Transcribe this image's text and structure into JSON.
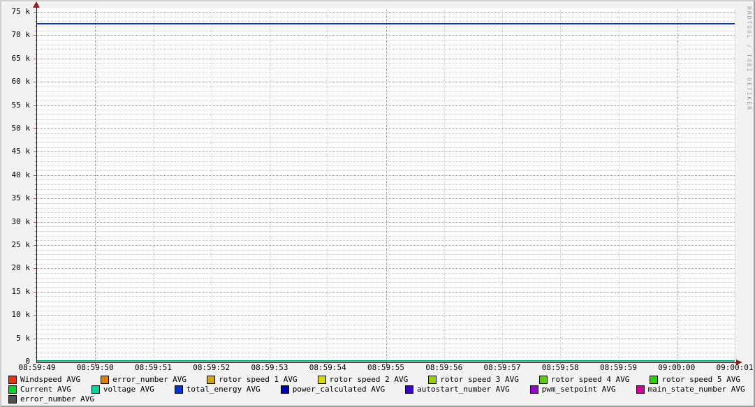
{
  "watermark": "RRDTOOL / TOBI OETIKER",
  "chart_data": {
    "type": "line",
    "title": "",
    "xlabel": "",
    "ylabel": "",
    "ylim": [
      0,
      75000
    ],
    "y_major_step": 5000,
    "y_minor_step": 1000,
    "y_tick_labels": [
      "0",
      "5 k",
      "10 k",
      "15 k",
      "20 k",
      "25 k",
      "30 k",
      "35 k",
      "40 k",
      "45 k",
      "50 k",
      "55 k",
      "60 k",
      "65 k",
      "70 k",
      "75 k"
    ],
    "x_labels": [
      "08:59:49",
      "08:59:50",
      "08:59:51",
      "08:59:52",
      "08:59:53",
      "08:59:54",
      "08:59:55",
      "08:59:56",
      "08:59:57",
      "08:59:58",
      "08:59:59",
      "09:00:00",
      "09:00:01"
    ],
    "x_major_indices": [
      1,
      6,
      11
    ],
    "grid": "on",
    "legend_position": "bottom",
    "series": [
      {
        "name": "Windspeed AVG",
        "color": "#e0370d",
        "row": 0,
        "value": 0
      },
      {
        "name": "error_number AVG",
        "color": "#db8300",
        "row": 0,
        "value": 0
      },
      {
        "name": "rotor speed 1 AVG",
        "color": "#d2a900",
        "row": 0,
        "value": 0
      },
      {
        "name": "rotor speed 2 AVG",
        "color": "#d8d800",
        "row": 0,
        "value": 0
      },
      {
        "name": "rotor speed 3 AVG",
        "color": "#97d000",
        "row": 0,
        "value": 0
      },
      {
        "name": "rotor speed 4 AVG",
        "color": "#5fcc00",
        "row": 0,
        "value": 0
      },
      {
        "name": "rotor speed 5 AVG",
        "color": "#2ecc00",
        "row": 0,
        "value": 0
      },
      {
        "name": "Current AVG",
        "color": "#00d52e",
        "row": 1,
        "value": 0
      },
      {
        "name": "voltage AVG",
        "color": "#00d59b",
        "row": 1,
        "value": 0
      },
      {
        "name": "total_energy AVG",
        "color": "#0433ce",
        "row": 1,
        "value": 72500
      },
      {
        "name": "power_calculated AVG",
        "color": "#0000a8",
        "row": 1,
        "value": 0
      },
      {
        "name": "autostart_number AVG",
        "color": "#3a06cc",
        "row": 1,
        "value": 0
      },
      {
        "name": "pwm_setpoint AVG",
        "color": "#9606cc",
        "row": 1,
        "value": 0
      },
      {
        "name": "main_state_number AVG",
        "color": "#d2009b",
        "row": 1,
        "value": 0
      },
      {
        "name": "error_number AVG",
        "color": "#4f4f4f",
        "row": 2,
        "value": 0
      }
    ],
    "visible_lines": [
      {
        "series": "total_energy AVG",
        "value": 72500,
        "color": "#0433ce",
        "thickness": 2
      },
      {
        "series": "zero baseline (all other series)",
        "value": 0,
        "color": "#00a87e",
        "thickness": 2
      }
    ]
  },
  "layout_colors": {
    "background": "#f2f2f2",
    "canvas": "#ffffff",
    "minor_grid": "#cccccc",
    "major_grid": "#cf7e7e",
    "axis": "#141414",
    "arrow": "#8f2020",
    "font": "#000000",
    "shade_top_left": "#cfcfcf",
    "shade_bottom_right": "#9e9e9e"
  }
}
